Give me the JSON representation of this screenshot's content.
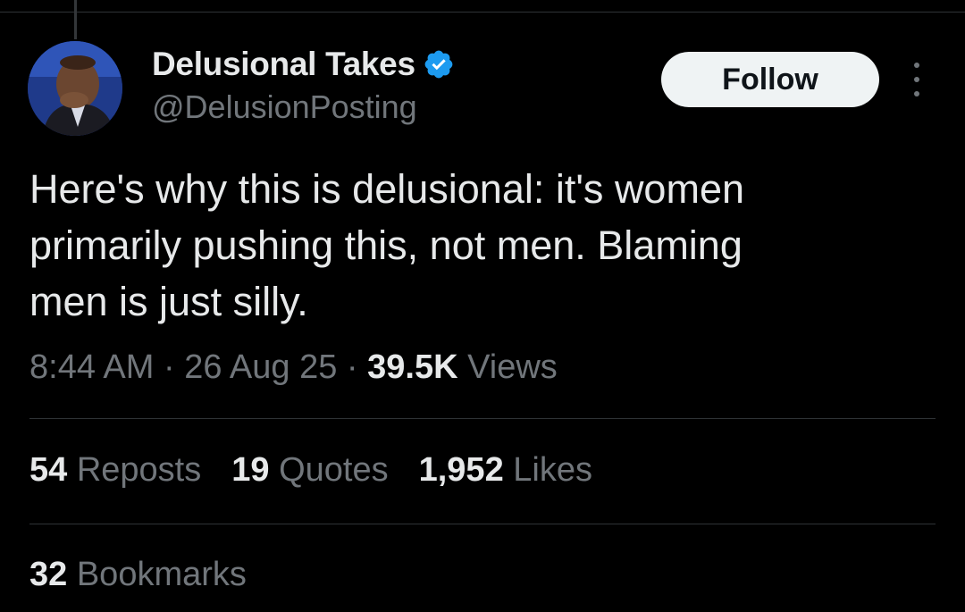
{
  "author": {
    "display_name": "Delusional Takes",
    "handle": "@DelusionPosting",
    "verified": true,
    "avatar_icon": "avatar-photo"
  },
  "actions": {
    "follow_label": "Follow",
    "more_icon": "more-vertical-icon"
  },
  "tweet": {
    "text": "Here's why this is delusional: it's women\nprimarily pushing this, not men. Blaming\nmen is just silly."
  },
  "meta": {
    "time": "8:44 AM",
    "sep1": " · ",
    "date": "26 Aug 25",
    "sep2": " · ",
    "views_count": "39.5K",
    "views_label": " Views"
  },
  "stats": {
    "reposts": {
      "count": "54",
      "label": " Reposts"
    },
    "quotes": {
      "count": "19",
      "label": " Quotes"
    },
    "likes": {
      "count": "1,952",
      "label": " Likes"
    },
    "bookmarks": {
      "count": "32",
      "label": " Bookmarks"
    }
  },
  "colors": {
    "background": "#000000",
    "primary_text": "#e7e9ea",
    "secondary_text": "#71767b",
    "verified_blue": "#1d9bf0",
    "follow_bg": "#eff3f4"
  }
}
